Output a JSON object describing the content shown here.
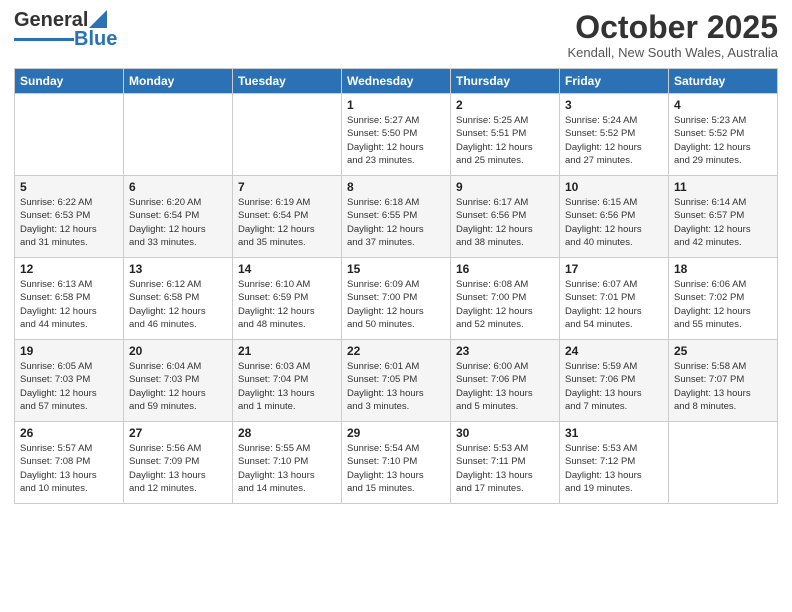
{
  "logo": {
    "general": "General",
    "blue": "Blue"
  },
  "title": "October 2025",
  "location": "Kendall, New South Wales, Australia",
  "weekdays": [
    "Sunday",
    "Monday",
    "Tuesday",
    "Wednesday",
    "Thursday",
    "Friday",
    "Saturday"
  ],
  "weeks": [
    [
      {
        "day": "",
        "info": ""
      },
      {
        "day": "",
        "info": ""
      },
      {
        "day": "",
        "info": ""
      },
      {
        "day": "1",
        "info": "Sunrise: 5:27 AM\nSunset: 5:50 PM\nDaylight: 12 hours\nand 23 minutes."
      },
      {
        "day": "2",
        "info": "Sunrise: 5:25 AM\nSunset: 5:51 PM\nDaylight: 12 hours\nand 25 minutes."
      },
      {
        "day": "3",
        "info": "Sunrise: 5:24 AM\nSunset: 5:52 PM\nDaylight: 12 hours\nand 27 minutes."
      },
      {
        "day": "4",
        "info": "Sunrise: 5:23 AM\nSunset: 5:52 PM\nDaylight: 12 hours\nand 29 minutes."
      }
    ],
    [
      {
        "day": "5",
        "info": "Sunrise: 6:22 AM\nSunset: 6:53 PM\nDaylight: 12 hours\nand 31 minutes."
      },
      {
        "day": "6",
        "info": "Sunrise: 6:20 AM\nSunset: 6:54 PM\nDaylight: 12 hours\nand 33 minutes."
      },
      {
        "day": "7",
        "info": "Sunrise: 6:19 AM\nSunset: 6:54 PM\nDaylight: 12 hours\nand 35 minutes."
      },
      {
        "day": "8",
        "info": "Sunrise: 6:18 AM\nSunset: 6:55 PM\nDaylight: 12 hours\nand 37 minutes."
      },
      {
        "day": "9",
        "info": "Sunrise: 6:17 AM\nSunset: 6:56 PM\nDaylight: 12 hours\nand 38 minutes."
      },
      {
        "day": "10",
        "info": "Sunrise: 6:15 AM\nSunset: 6:56 PM\nDaylight: 12 hours\nand 40 minutes."
      },
      {
        "day": "11",
        "info": "Sunrise: 6:14 AM\nSunset: 6:57 PM\nDaylight: 12 hours\nand 42 minutes."
      }
    ],
    [
      {
        "day": "12",
        "info": "Sunrise: 6:13 AM\nSunset: 6:58 PM\nDaylight: 12 hours\nand 44 minutes."
      },
      {
        "day": "13",
        "info": "Sunrise: 6:12 AM\nSunset: 6:58 PM\nDaylight: 12 hours\nand 46 minutes."
      },
      {
        "day": "14",
        "info": "Sunrise: 6:10 AM\nSunset: 6:59 PM\nDaylight: 12 hours\nand 48 minutes."
      },
      {
        "day": "15",
        "info": "Sunrise: 6:09 AM\nSunset: 7:00 PM\nDaylight: 12 hours\nand 50 minutes."
      },
      {
        "day": "16",
        "info": "Sunrise: 6:08 AM\nSunset: 7:00 PM\nDaylight: 12 hours\nand 52 minutes."
      },
      {
        "day": "17",
        "info": "Sunrise: 6:07 AM\nSunset: 7:01 PM\nDaylight: 12 hours\nand 54 minutes."
      },
      {
        "day": "18",
        "info": "Sunrise: 6:06 AM\nSunset: 7:02 PM\nDaylight: 12 hours\nand 55 minutes."
      }
    ],
    [
      {
        "day": "19",
        "info": "Sunrise: 6:05 AM\nSunset: 7:03 PM\nDaylight: 12 hours\nand 57 minutes."
      },
      {
        "day": "20",
        "info": "Sunrise: 6:04 AM\nSunset: 7:03 PM\nDaylight: 12 hours\nand 59 minutes."
      },
      {
        "day": "21",
        "info": "Sunrise: 6:03 AM\nSunset: 7:04 PM\nDaylight: 13 hours\nand 1 minute."
      },
      {
        "day": "22",
        "info": "Sunrise: 6:01 AM\nSunset: 7:05 PM\nDaylight: 13 hours\nand 3 minutes."
      },
      {
        "day": "23",
        "info": "Sunrise: 6:00 AM\nSunset: 7:06 PM\nDaylight: 13 hours\nand 5 minutes."
      },
      {
        "day": "24",
        "info": "Sunrise: 5:59 AM\nSunset: 7:06 PM\nDaylight: 13 hours\nand 7 minutes."
      },
      {
        "day": "25",
        "info": "Sunrise: 5:58 AM\nSunset: 7:07 PM\nDaylight: 13 hours\nand 8 minutes."
      }
    ],
    [
      {
        "day": "26",
        "info": "Sunrise: 5:57 AM\nSunset: 7:08 PM\nDaylight: 13 hours\nand 10 minutes."
      },
      {
        "day": "27",
        "info": "Sunrise: 5:56 AM\nSunset: 7:09 PM\nDaylight: 13 hours\nand 12 minutes."
      },
      {
        "day": "28",
        "info": "Sunrise: 5:55 AM\nSunset: 7:10 PM\nDaylight: 13 hours\nand 14 minutes."
      },
      {
        "day": "29",
        "info": "Sunrise: 5:54 AM\nSunset: 7:10 PM\nDaylight: 13 hours\nand 15 minutes."
      },
      {
        "day": "30",
        "info": "Sunrise: 5:53 AM\nSunset: 7:11 PM\nDaylight: 13 hours\nand 17 minutes."
      },
      {
        "day": "31",
        "info": "Sunrise: 5:53 AM\nSunset: 7:12 PM\nDaylight: 13 hours\nand 19 minutes."
      },
      {
        "day": "",
        "info": ""
      }
    ]
  ]
}
